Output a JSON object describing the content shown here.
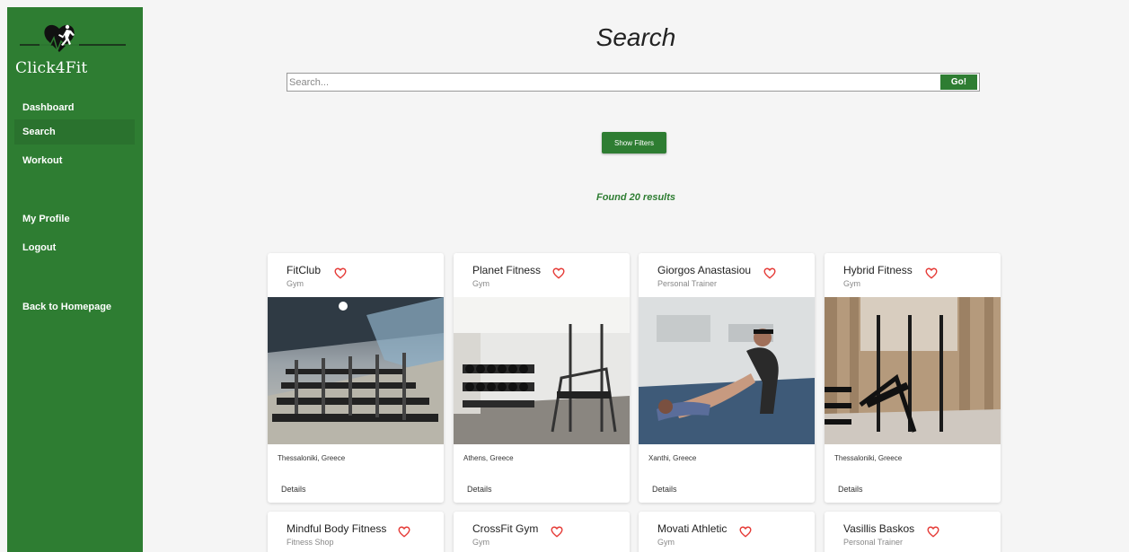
{
  "sidebar": {
    "logo_text": "Click4Fit",
    "items": [
      {
        "label": "Dashboard"
      },
      {
        "label": "Search"
      },
      {
        "label": "Workout"
      },
      {
        "label": "My Profile"
      },
      {
        "label": "Logout"
      },
      {
        "label": "Back to Homepage"
      }
    ],
    "active": "Search"
  },
  "main": {
    "title": "Search",
    "search": {
      "placeholder": "Search...",
      "value": "",
      "go_label": "Go!"
    },
    "filters_label": "Show Filters",
    "results_text": "Found 20 results",
    "cards": [
      {
        "name": "FitClub",
        "type": "Gym",
        "location": "Thessaloniki, Greece",
        "details": "Details",
        "image": "gym-hall-image"
      },
      {
        "name": "Planet Fitness",
        "type": "Gym",
        "location": "Athens, Greece",
        "details": "Details",
        "image": "weights-room-image"
      },
      {
        "name": "Giorgos Anastasiou",
        "type": "Personal Trainer",
        "location": "Xanthi, Greece",
        "details": "Details",
        "image": "trainer-stretching-image"
      },
      {
        "name": "Hybrid Fitness",
        "type": "Gym",
        "location": "Thessaloniki, Greece",
        "details": "Details",
        "image": "wooden-gym-image"
      },
      {
        "name": "Mindful Body Fitness",
        "type": "Fitness Shop"
      },
      {
        "name": "CrossFit Gym",
        "type": "Gym"
      },
      {
        "name": "Movati Athletic",
        "type": "Gym"
      },
      {
        "name": "Vasillis Baskos",
        "type": "Personal Trainer"
      }
    ]
  },
  "colors": {
    "brand_green": "#2e7d32",
    "heart_red": "#e53935",
    "page_bg": "#f5f5f5"
  },
  "icons": [
    "heart-logo-icon",
    "runner-icon",
    "favorite-heart-icon"
  ]
}
